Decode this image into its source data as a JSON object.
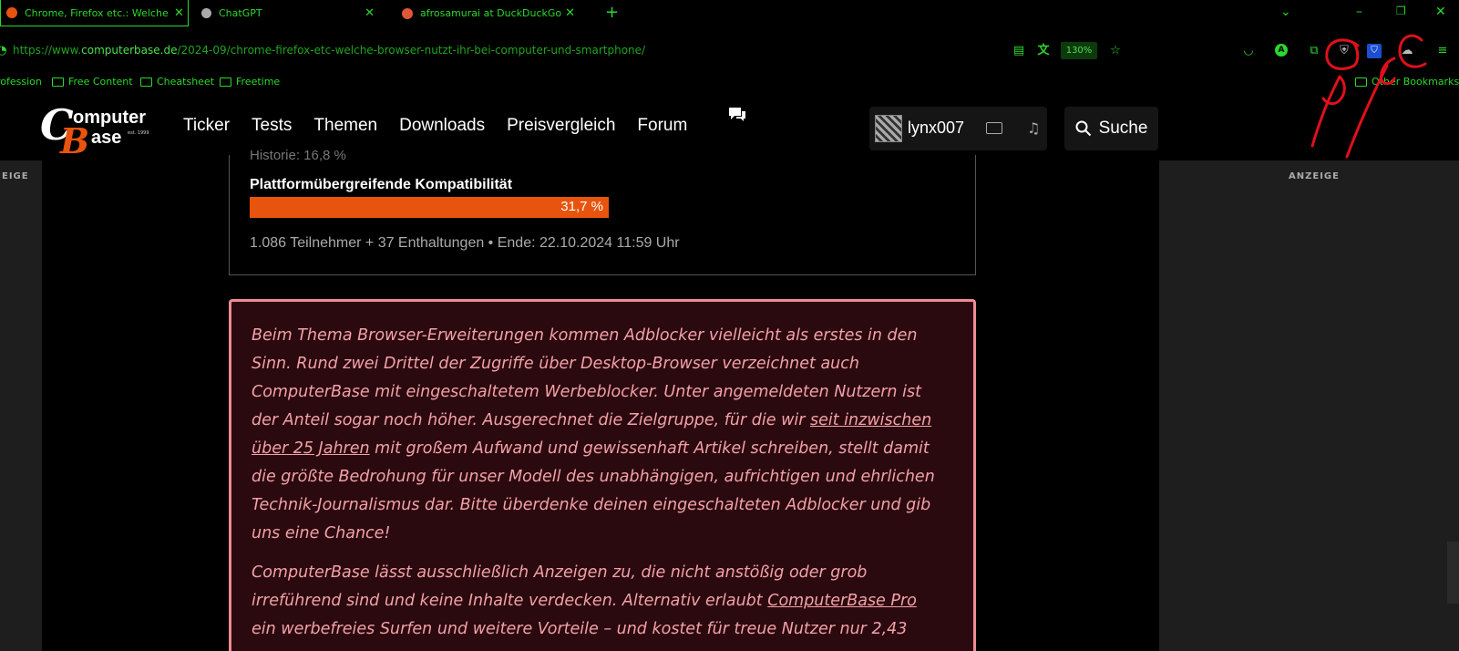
{
  "browser": {
    "tabs": [
      {
        "title": "Chrome, Firefox etc.: Welche Br",
        "favicon_color": "#e8540d",
        "active": true
      },
      {
        "title": "ChatGPT",
        "favicon_color": "#aaaaaa",
        "active": false
      },
      {
        "title": "afrosamurai at DuckDuckGo",
        "favicon_color": "#de5833",
        "active": false
      }
    ],
    "new_tab_label": "+",
    "url_prefix": "https://www.",
    "url_host": "computerbase.de",
    "url_path": "/2024-09/chrome-firefox-etc-welche-browser-nutzt-ihr-bei-computer-und-smartphone/",
    "zoom": "130%",
    "bookmarks": [
      "rofession",
      "Free Content",
      "Cheatsheet",
      "Freetime"
    ],
    "other_bookmarks": "Other Bookmarks"
  },
  "site": {
    "logo_c": "C",
    "logo_b": "B",
    "logo_word1": "omputer",
    "logo_word2": "ase",
    "logo_est": "est. 1999",
    "nav": [
      "Ticker",
      "Tests",
      "Themen",
      "Downloads",
      "Preisvergleich",
      "Forum"
    ],
    "username": "lynx007",
    "search_label": "Suche"
  },
  "sides": {
    "left_label": "EIGE",
    "right_label": "ANZEIGE"
  },
  "poll": {
    "previous_row": "Historie: 16,8 %",
    "label": "Plattformübergreifende Kompatibilität",
    "percent_text": "31,7 %",
    "percent_value": 31.7,
    "meta": "1.086 Teilnehmer  +  37 Enthaltungen  •  Ende: 22.10.2024 11:59 Uhr"
  },
  "adblock_notice": {
    "p1_a": "Beim Thema Browser-Erweiterungen kommen Adblocker vielleicht als erstes in den Sinn. Rund zwei Drittel der Zugriffe über Desktop-Browser verzeichnet auch ComputerBase mit eingeschaltetem Werbeblocker. Unter angemeldeten Nutzern ist der Anteil sogar noch höher. Ausgerechnet die Zielgruppe, für die wir ",
    "p1_link": "seit inzwischen über 25 Jahren",
    "p1_b": " mit großem Aufwand und gewissenhaft Artikel schreiben, stellt damit die größte Bedrohung für unser Modell des unabhängigen, aufrichtigen und ehrlichen Technik-Journalismus dar. Bitte überdenke deinen eingeschalteten Adblocker und gib uns eine Chance!",
    "p2_a": "ComputerBase lässt ausschließlich Anzeigen zu, die nicht anstößig oder grob irreführend sind und keine Inhalte verdecken. Alternativ erlaubt ",
    "p2_link": "ComputerBase Pro",
    "p2_b": " ein werbefreies Surfen und weitere Vorteile – und kostet für treue Nutzer nur 2,43",
    "accent": "#f08a94",
    "background": "#2a0a0f"
  },
  "colors": {
    "browser_accent": "#2bd92b",
    "brand_orange": "#e8540d",
    "annotation_red": "#e0101a"
  }
}
